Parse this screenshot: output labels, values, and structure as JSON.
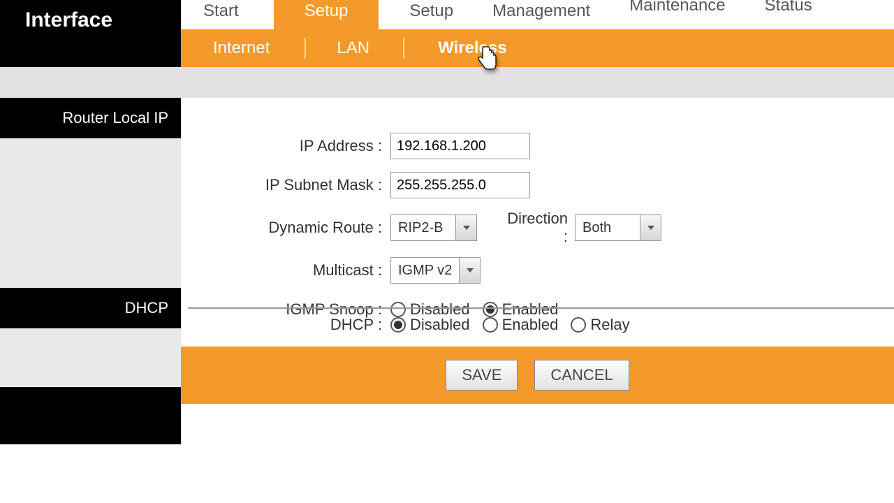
{
  "brand": {
    "title": "Interface"
  },
  "top_tabs": {
    "start": "Start",
    "setup": "Setup",
    "setup2": "Setup",
    "management": "Management",
    "maintenance": "Maintenance",
    "status": "Status"
  },
  "sub_tabs": {
    "internet": "Internet",
    "lan": "LAN",
    "wireless": "Wireless"
  },
  "sections": {
    "router_local_ip": "Router Local IP",
    "dhcp": "DHCP"
  },
  "form": {
    "ip_address_label": "IP Address :",
    "ip_address_value": "192.168.1.200",
    "subnet_label": "IP Subnet Mask :",
    "subnet_value": "255.255.255.0",
    "dynamic_route_label": "Dynamic Route :",
    "dynamic_route_value": "RIP2-B",
    "direction_label": "Direction :",
    "direction_value": "Both",
    "multicast_label": "Multicast :",
    "multicast_value": "IGMP v2",
    "igmp_snoop_label": "IGMP Snoop :",
    "igmp_snoop_disabled": "Disabled",
    "igmp_snoop_enabled": "Enabled",
    "dhcp_label": "DHCP :",
    "dhcp_disabled": "Disabled",
    "dhcp_enabled": "Enabled",
    "dhcp_relay": "Relay"
  },
  "buttons": {
    "save": "SAVE",
    "cancel": "CANCEL"
  }
}
